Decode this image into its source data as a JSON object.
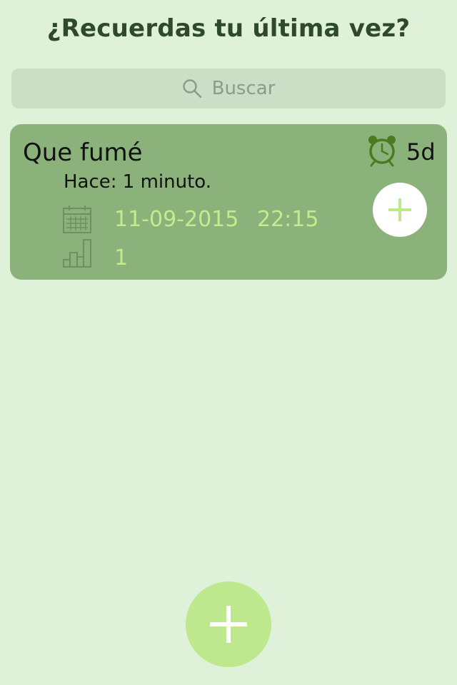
{
  "header": {
    "title": "¿Recuerdas tu última vez?"
  },
  "search": {
    "placeholder": "Buscar",
    "icon": "search-icon"
  },
  "items": [
    {
      "name": "Que fumé",
      "alarm_icon": "alarm-clock-icon",
      "alarm_label": "5d",
      "ago": "Hace: 1 minuto.",
      "calendar_icon": "calendar-icon",
      "date": "11-09-2015",
      "time": "22:15",
      "stats_icon": "bar-chart-icon",
      "count": "1",
      "add_icon": "plus-icon"
    }
  ],
  "fab": {
    "icon": "plus-icon"
  },
  "colors": {
    "background": "#dff1d8",
    "card": "#8cb27b",
    "accent": "#bde88e",
    "value_text": "#c3ec8d",
    "alarm": "#4d7a1f"
  }
}
